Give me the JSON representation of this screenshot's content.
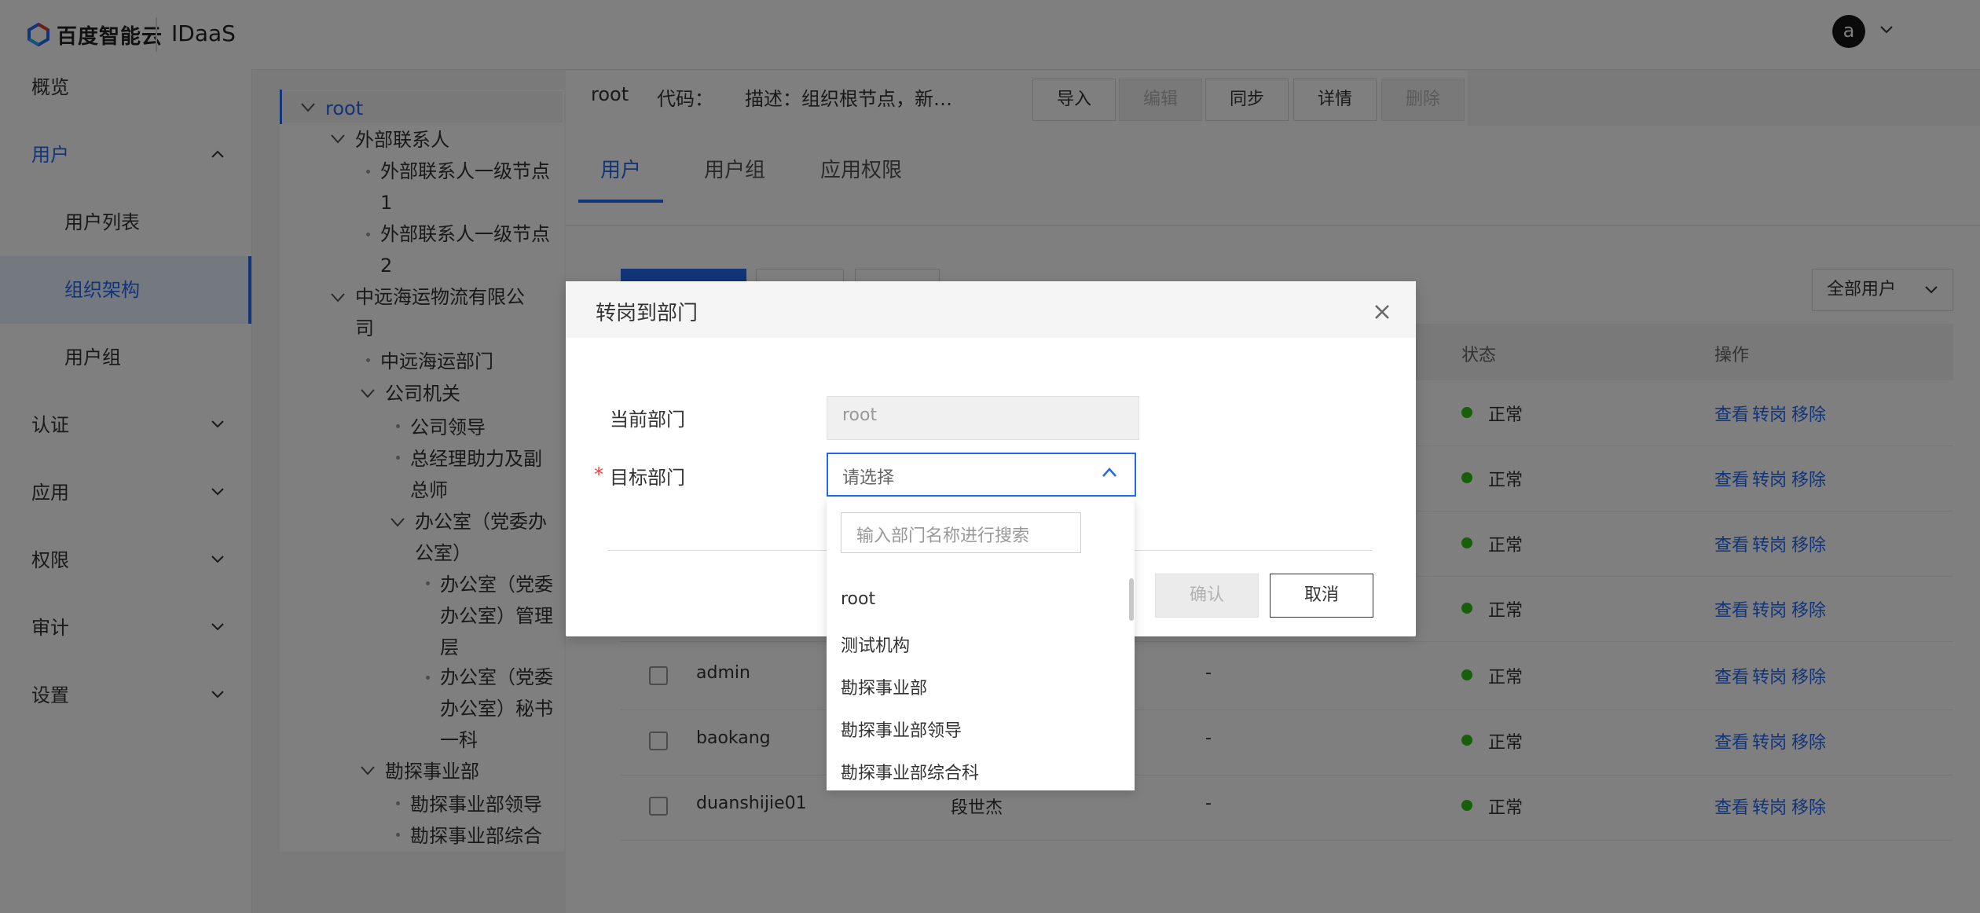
{
  "header": {
    "brand": "百度智能云",
    "app_name": "IDaaS",
    "avatar_letter": "a"
  },
  "sidebar": {
    "items": [
      {
        "label": "概览"
      },
      {
        "label": "用户"
      },
      {
        "label": "用户列表"
      },
      {
        "label": "组织架构"
      },
      {
        "label": "用户组"
      },
      {
        "label": "认证"
      },
      {
        "label": "应用"
      },
      {
        "label": "权限"
      },
      {
        "label": "审计"
      },
      {
        "label": "设置"
      }
    ]
  },
  "tree": {
    "nodes": [
      {
        "label": "root"
      },
      {
        "label": "外部联系人"
      },
      {
        "label": "外部联系人一级节点1"
      },
      {
        "label": "外部联系人一级节点2"
      },
      {
        "label": "中远海运物流有限公司"
      },
      {
        "label": "中远海运部门"
      },
      {
        "label": "公司机关"
      },
      {
        "label": "公司领导"
      },
      {
        "label": "总经理助力及副总师"
      },
      {
        "label": "办公室（党委办公室）"
      },
      {
        "label": "办公室（党委办公室）管理层"
      },
      {
        "label": "办公室（党委办公室）秘书一科"
      },
      {
        "label": "勘探事业部"
      },
      {
        "label": "勘探事业部领导"
      },
      {
        "label": "勘探事业部综合"
      }
    ]
  },
  "org": {
    "name": "root",
    "code_label": "代码：",
    "desc_label": "描述：组织根节点，新…"
  },
  "toolbar": {
    "import": "导入",
    "edit": "编辑",
    "sync": "同步",
    "details": "详情",
    "delete": "删除"
  },
  "tabs": [
    {
      "label": "用户"
    },
    {
      "label": "用户组"
    },
    {
      "label": "应用权限"
    }
  ],
  "filter": {
    "label": "全部用户"
  },
  "table": {
    "headers": {
      "status": "状态",
      "operation": "操作"
    },
    "rows": [
      {
        "username": "",
        "name": "",
        "extra": "",
        "status": "正常"
      },
      {
        "username": "",
        "name": "",
        "extra": "",
        "status": "正常"
      },
      {
        "username": "",
        "name": "",
        "extra": "",
        "status": "正常"
      },
      {
        "username": "",
        "name": "",
        "extra": "",
        "status": "正常"
      },
      {
        "username": "admin",
        "name": "",
        "extra": "-",
        "status": "正常"
      },
      {
        "username": "baokang",
        "name": "",
        "extra": "-",
        "status": "正常"
      },
      {
        "username": "duanshijie01",
        "name": "段世杰",
        "extra": "-",
        "status": "正常"
      }
    ],
    "ops": {
      "view": "查看",
      "transfer": "转岗",
      "remove": "移除"
    }
  },
  "dialog": {
    "title": "转岗到部门",
    "current_label": "当前部门",
    "current_value": "root",
    "target_label": "目标部门",
    "required_mark": "*",
    "target_placeholder": "请选择",
    "confirm": "确认",
    "cancel": "取消"
  },
  "dropdown": {
    "search_placeholder": "输入部门名称进行搜索",
    "options": [
      "root",
      "测试机构",
      "勘探事业部",
      "勘探事业部领导",
      "勘探事业部综合科"
    ]
  },
  "colors": {
    "accent": "#2468f2",
    "status_ok": "#30bf13",
    "required": "#f33e3e"
  }
}
